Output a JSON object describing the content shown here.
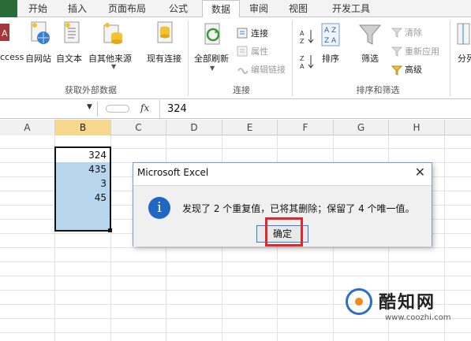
{
  "ribbon_tabs": [
    "开始",
    "插入",
    "页面布局",
    "公式",
    "数据",
    "审阅",
    "视图",
    "开发工具"
  ],
  "active_tab": "数据",
  "ribbon": {
    "get_external": {
      "access": "ccess",
      "web": "自网站",
      "text": "自文本",
      "other": "自其他来源",
      "existing": "现有连接",
      "title": "获取外部数据"
    },
    "connections": {
      "refresh_all": "全部刷新",
      "connections": "连接",
      "properties": "属性",
      "edit_links": "编辑链接",
      "title": "连接"
    },
    "sort_filter": {
      "sort": "排序",
      "filter": "筛选",
      "clear": "清除",
      "reapply": "重新应用",
      "advanced": "高级",
      "title": "排序和筛选"
    },
    "split": "分列"
  },
  "formula_bar": {
    "fx_label": "fx",
    "value": "324"
  },
  "columns": [
    "A",
    "B",
    "C",
    "D",
    "E",
    "F",
    "G",
    "H"
  ],
  "selected_column": "B",
  "cells_b": [
    "324",
    "435",
    "3",
    "45"
  ],
  "dialog": {
    "title": "Microsoft Excel",
    "close": "✕",
    "icon": "i",
    "message": "发现了 2 个重复值，已将其删除；保留了 4 个唯一值。",
    "ok_label": "确定"
  },
  "watermark": {
    "name": "酷知网",
    "url": "www.coozhi.com"
  },
  "colors": {
    "selection_fill": "#b8d5ee",
    "selected_header": "#f7d88c",
    "info_icon": "#1f67c2",
    "highlight_box": "#e0272f"
  }
}
